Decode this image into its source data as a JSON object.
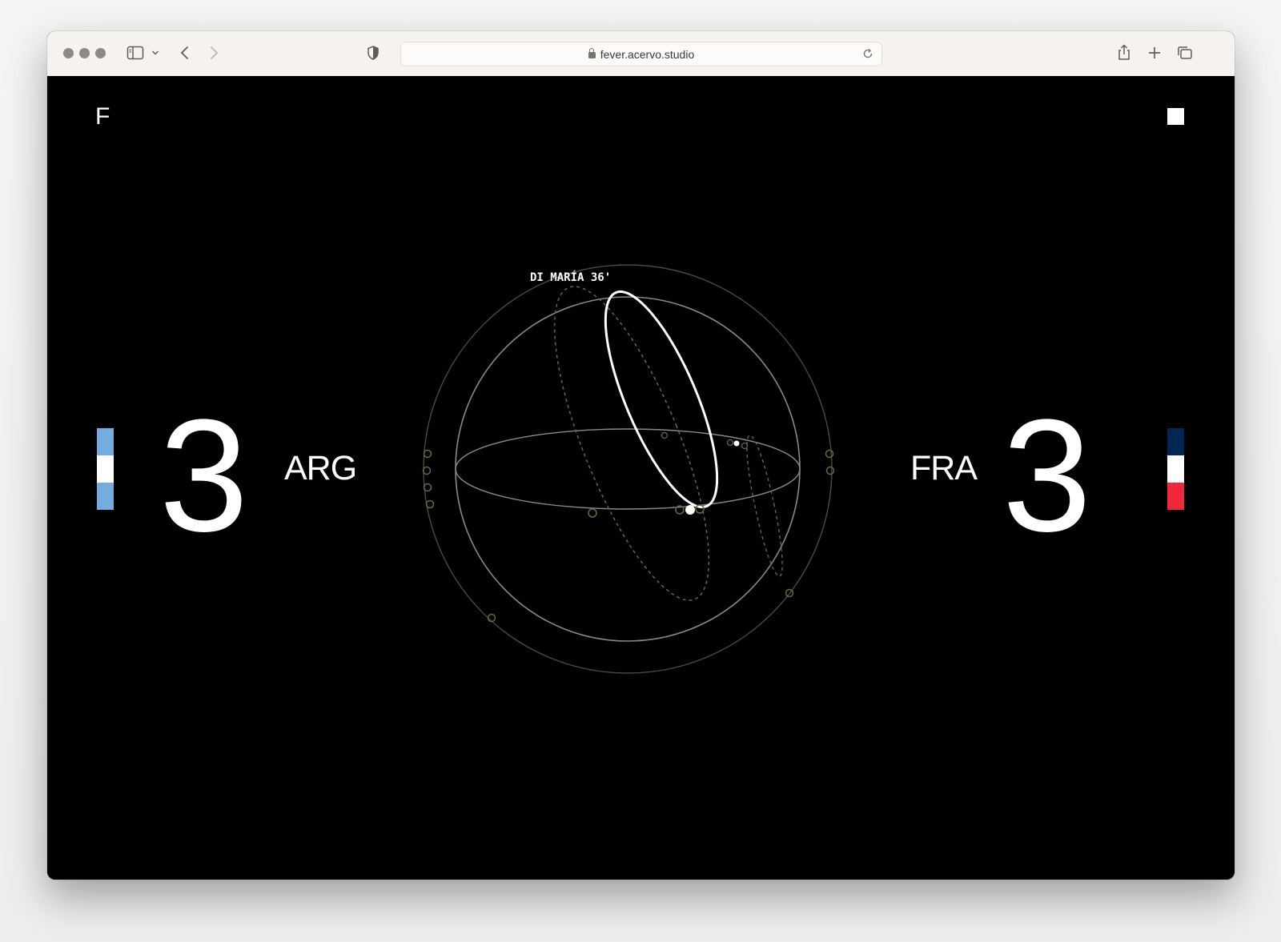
{
  "browser": {
    "url": "fever.acervo.studio",
    "icons": [
      "sidebar-icon",
      "chevron-down-icon",
      "back-icon",
      "forward-icon",
      "shield-icon",
      "lock-icon",
      "reload-icon",
      "share-icon",
      "new-tab-icon",
      "tabs-overview-icon"
    ]
  },
  "page": {
    "logo": "F",
    "home": {
      "team": "ARG",
      "score": "3",
      "flag_colors": [
        "#74ACDF",
        "#FFFFFF",
        "#74ACDF"
      ]
    },
    "away": {
      "team": "FRA",
      "score": "3",
      "flag_colors": [
        "#002654",
        "#FFFFFF",
        "#ED2939"
      ]
    },
    "goal_label": "DI MARÍA 36'"
  }
}
